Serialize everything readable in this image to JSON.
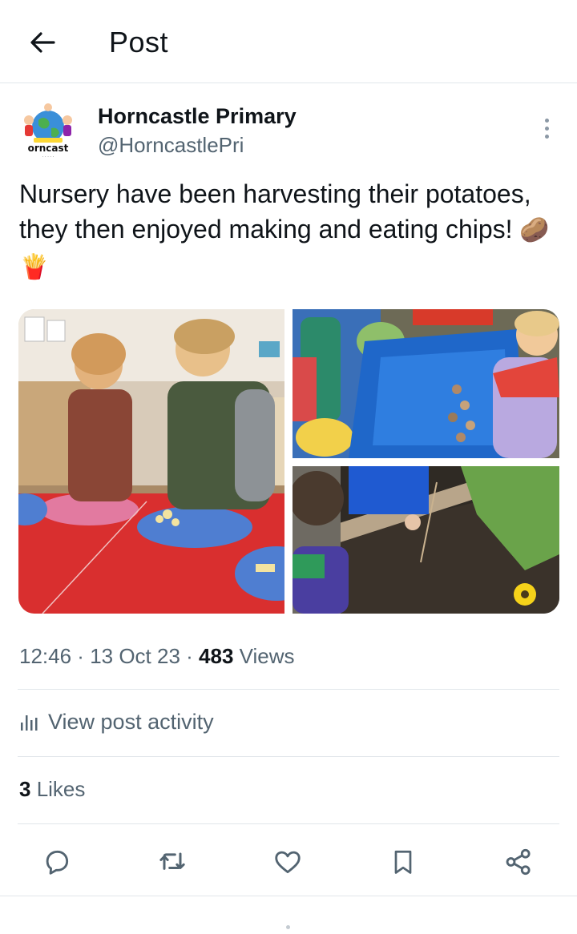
{
  "header": {
    "title": "Post",
    "back_icon": "arrow-left-icon"
  },
  "author": {
    "name": "Horncastle Primary",
    "handle": "@HorncastlePri",
    "avatar_text": "orncast"
  },
  "post": {
    "text": "Nursery have been harvesting their potatoes, they then enjoyed making and eating chips!",
    "emoji_1": "🥔",
    "emoji_2": "🍟",
    "images": [
      {
        "name": "children-cutting-potatoes"
      },
      {
        "name": "child-with-potatoes-in-tray"
      },
      {
        "name": "child-digging-potatoes"
      }
    ]
  },
  "meta": {
    "time": "12:46",
    "sep1": " · ",
    "date": "13 Oct 23",
    "sep2": " · ",
    "views_count": "483",
    "views_label": " Views"
  },
  "activity": {
    "label": "View post activity",
    "icon": "bar-chart-icon"
  },
  "likes": {
    "count": "3",
    "label": " Likes"
  },
  "actions": [
    {
      "name": "reply",
      "icon": "reply-icon"
    },
    {
      "name": "repost",
      "icon": "repost-icon"
    },
    {
      "name": "like",
      "icon": "heart-icon"
    },
    {
      "name": "bookmark",
      "icon": "bookmark-icon"
    },
    {
      "name": "share",
      "icon": "share-icon"
    }
  ],
  "colors": {
    "text": "#0f1419",
    "secondary": "#536471",
    "divider": "#e1e6ea"
  }
}
